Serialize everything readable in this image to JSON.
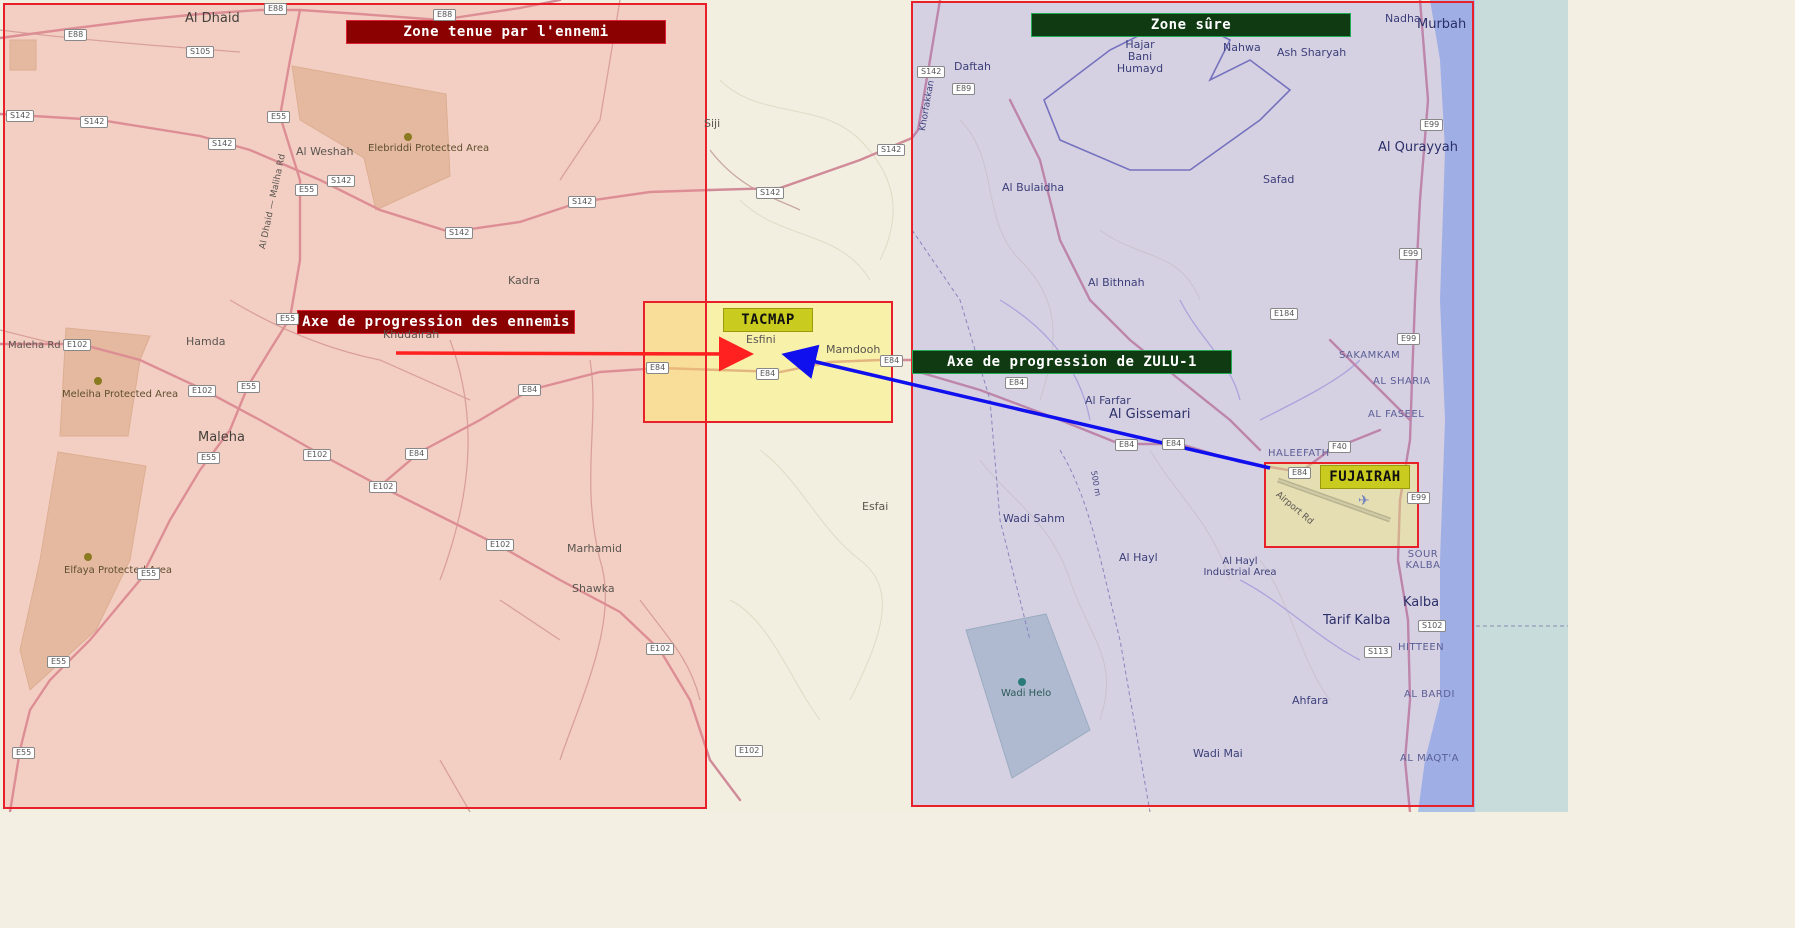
{
  "map": {
    "overlay_labels": {
      "enemy_zone": "Zone tenue par l'ennemi",
      "safe_zone": "Zone sûre",
      "enemy_axis": "Axe de progression des ennemis",
      "zulu_axis": "Axe de progression de ZULU-1",
      "tacmap": "TACMAP",
      "fujairah": "FUJAIRAH"
    },
    "places": [
      "Al Dhaid",
      "Siji",
      "Al Weshah",
      "Elebriddi Protected Area",
      "Kadra",
      "Hamda",
      "Khudairah",
      "Maleha",
      "Meleiha Protected Area",
      "Elfaya Protected Area",
      "Marhamid",
      "Shawka",
      "Esfini",
      "Mamdooh",
      "Esfai",
      "Daftah",
      "Hajar Bani Humayd",
      "Nahwa",
      "Ash Sharyah",
      "Murbah",
      "Al Qurayyah",
      "Safad",
      "Al Bulaidha",
      "Al Bithnah",
      "Al Farfar",
      "Al Gissemari",
      "Wadi Sahm",
      "Al Hayl",
      "Al Hayl Industrial Area",
      "Tarif Kalba",
      "Kalba",
      "Ahfara",
      "Wadi Helo",
      "Wadi Mai",
      "SAKAMKAM",
      "AL SHARIA",
      "AL FASEEL",
      "HALEEFATH",
      "SOUR KALBA",
      "HITTEEN",
      "AL BARDI",
      "AL MAQT'A",
      "Maleha Rd",
      "Al Dhaid — Maliha Rd",
      "Khorfakkan Rd",
      "Airport Rd",
      "500 m",
      "Nadha"
    ],
    "road_shields": [
      "E88",
      "S105",
      "E55",
      "S142",
      "E102",
      "E84",
      "E89",
      "E99",
      "E184",
      "F40",
      "S102",
      "S113"
    ],
    "colors": {
      "enemy_fill": "rgba(245,150,140,0.35)",
      "safe_fill": "rgba(130,120,230,0.25)",
      "tacmap_fill": "rgba(255,245,90,0.40)",
      "zone_border": "#e8202a",
      "enemy_arrow": "#ff2020",
      "zulu_arrow": "#1010ee",
      "sea": "#aac0e0"
    }
  }
}
